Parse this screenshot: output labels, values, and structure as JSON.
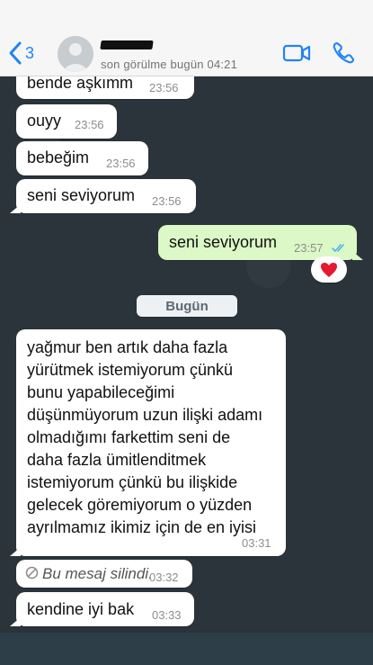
{
  "header": {
    "back_count": "3",
    "status": "son görülme bugün 04:21"
  },
  "messages": {
    "m1": {
      "text": "bende aşkımm",
      "time": "23:56"
    },
    "m2": {
      "text": "ouyy",
      "time": "23:56"
    },
    "m3": {
      "text": "bebeğim",
      "time": "23:56"
    },
    "m4": {
      "text": "seni seviyorum",
      "time": "23:56"
    },
    "m5": {
      "text": "seni seviyorum",
      "time": "23:57"
    },
    "m6": {
      "text": "yağmur ben artık daha fazla\nyürütmek istemiyorum çünkü\nbunu yapabileceğimi\ndüşünmüyorum uzun ilişki adamı\nolmadığımı farkettim seni de\ndaha fazla ümitlenditmek\nistemiyorum çünkü bu ilişkide\ngelecek göremiyorum o yüzden\nayrılmamız ikimiz için de en iyisi",
      "time": "03:31"
    },
    "m7": {
      "text": "Bu mesaj silindi.",
      "time": "03:32"
    },
    "m8": {
      "text": "kendine iyi bak",
      "time": "03:33"
    }
  },
  "day_separator": "Bugün",
  "reaction": {
    "icon": "heart-icon",
    "color": "#e5192f"
  },
  "colors": {
    "accent": "#1f84f6",
    "outgoing_bubble": "#dbf8c6",
    "read_ticks": "#4fb6ec"
  }
}
